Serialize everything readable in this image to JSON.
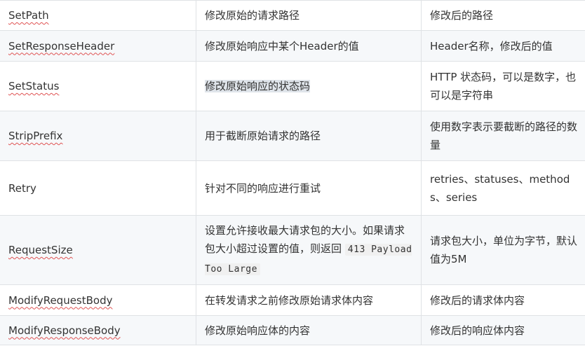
{
  "rows": [
    {
      "name": "SetPath",
      "desc": "修改原始的请求路径",
      "param": "修改后的路径"
    },
    {
      "name": "SetResponseHeader",
      "desc": "修改原始响应中某个Header的值",
      "param": "Header名称，修改后的值"
    },
    {
      "name": "SetStatus",
      "desc": "修改原始响应的状态码",
      "param": "HTTP 状态码，可以是数字，也可以是字符串"
    },
    {
      "name": "StripPrefix",
      "desc": "用于截断原始请求的路径",
      "param": "使用数字表示要截断的路径的数量"
    },
    {
      "name": "Retry",
      "desc": "针对不同的响应进行重试",
      "param": "retries、statuses、methods、series"
    },
    {
      "name": "RequestSize",
      "desc": "设置允许接收最大请求包的大小。如果请求包大小超过设置的值，则返回",
      "desc_code": "413 Payload Too Large",
      "param": "请求包大小，单位为字节，默认值为5M"
    },
    {
      "name": "ModifyRequestBody",
      "desc": "在转发请求之前修改原始请求体内容",
      "param": "修改后的请求体内容"
    },
    {
      "name": "ModifyResponseBody",
      "desc": "修改原始响应体的内容",
      "param": "修改后的响应体内容"
    }
  ]
}
